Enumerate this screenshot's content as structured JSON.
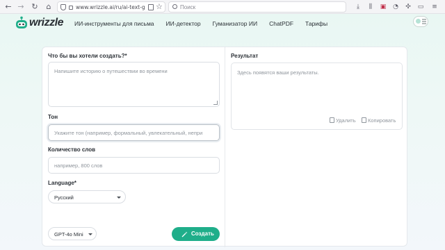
{
  "browser": {
    "url": "www.wrizzle.ai/ru/ai-text-gene",
    "search_placeholder": "Поиск"
  },
  "site": {
    "logo_text": "wrizzle",
    "nav": [
      "ИИ-инструменты для письма",
      "ИИ-детектор",
      "Гуманизатор ИИ",
      "ChatPDF",
      "Тарифы"
    ]
  },
  "form": {
    "prompt_label": "Что бы вы хотели создать?*",
    "prompt_placeholder": "Напишите историю о путешествии во времени",
    "tone_label": "Тон",
    "tone_placeholder": "Укажите тон (например, формальный, увлекательный, непри",
    "word_count_label": "Количество слов",
    "word_count_placeholder": "например, 800 слов",
    "language_label": "Language*",
    "language_value": "Русский",
    "model_value": "GPT-4o Mini",
    "create_label": "Создать"
  },
  "result": {
    "label": "Результат",
    "placeholder": "Здесь появятся ваши результаты.",
    "delete_label": "Удалить",
    "copy_label": "Копировать"
  },
  "colors": {
    "accent": "#1fae8a",
    "header_bg": "#e9f7f3"
  }
}
